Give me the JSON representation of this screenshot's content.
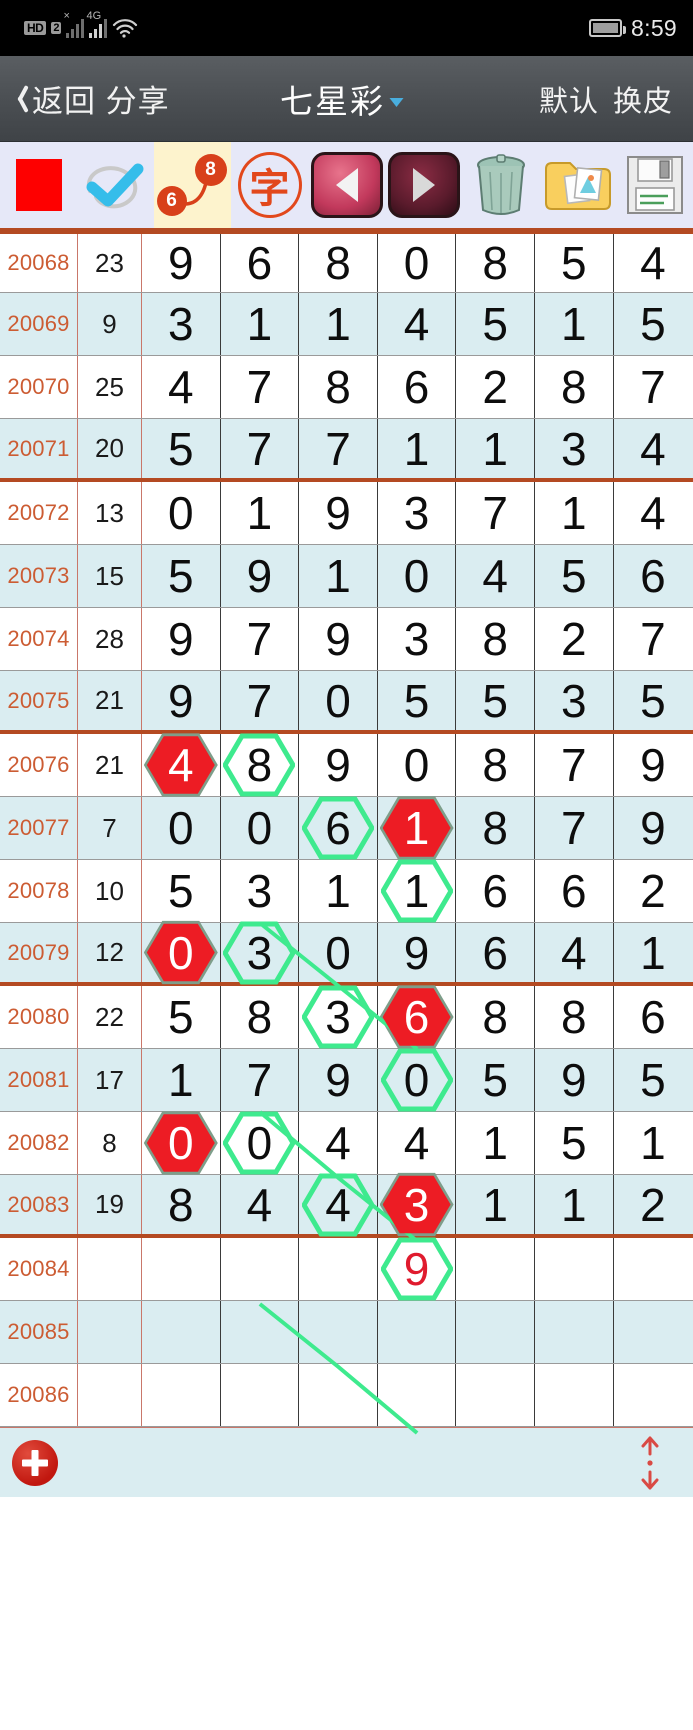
{
  "statusbar": {
    "hd_label": "HD",
    "sim_label": "2",
    "sim1_sup": "×",
    "net_label": "4G",
    "wifi_icon": "wifi-icon",
    "battery_icon": "battery-icon",
    "time": "8:59"
  },
  "appbar": {
    "back_icon": "chevron-left-icon",
    "back_label": "返回 分享",
    "title": "七星彩",
    "title_caret_icon": "chevron-down-icon",
    "action_default": "默认",
    "action_skin": "换皮"
  },
  "toolbar": {
    "items": [
      {
        "name": "red-square-icon",
        "label": "",
        "selected": false
      },
      {
        "name": "check-mark-icon",
        "label": "",
        "selected": false
      },
      {
        "name": "number-link-6-8-icon",
        "label": "6 8",
        "selected": true
      },
      {
        "name": "chinese-zi-stamp-icon",
        "label": "字",
        "selected": false
      },
      {
        "name": "prev-arrow-icon",
        "label": "",
        "selected": false
      },
      {
        "name": "next-arrow-icon",
        "label": "",
        "selected": false
      },
      {
        "name": "trash-can-icon",
        "label": "",
        "selected": false
      },
      {
        "name": "photo-folder-icon",
        "label": "",
        "selected": false
      },
      {
        "name": "floppy-save-icon",
        "label": "",
        "selected": false
      }
    ],
    "badge_6": "6",
    "badge_8": "8"
  },
  "colors": {
    "accent_orange": "#b44a22",
    "issue_text": "#cc5c33",
    "row_alt": "#daedf1",
    "marker_red": "#ed1c24",
    "marker_green": "#3eea8e",
    "prediction_red": "#e01b2e",
    "selected_tool_bg": "#fdf3cd"
  },
  "table": {
    "rows": [
      {
        "issue": "20068",
        "sum": "23",
        "nums": [
          "9",
          "6",
          "8",
          "0",
          "8",
          "5",
          "4"
        ],
        "marks": [
          null,
          null,
          null,
          null,
          null,
          null,
          null
        ]
      },
      {
        "issue": "20069",
        "sum": "9",
        "nums": [
          "3",
          "1",
          "1",
          "4",
          "5",
          "1",
          "5"
        ],
        "marks": [
          null,
          null,
          null,
          null,
          null,
          null,
          null
        ]
      },
      {
        "issue": "20070",
        "sum": "25",
        "nums": [
          "4",
          "7",
          "8",
          "6",
          "2",
          "8",
          "7"
        ],
        "marks": [
          null,
          null,
          null,
          null,
          null,
          null,
          null
        ]
      },
      {
        "issue": "20071",
        "sum": "20",
        "nums": [
          "5",
          "7",
          "7",
          "1",
          "1",
          "3",
          "4"
        ],
        "marks": [
          null,
          null,
          null,
          null,
          null,
          null,
          null
        ]
      },
      {
        "issue": "20072",
        "sum": "13",
        "nums": [
          "0",
          "1",
          "9",
          "3",
          "7",
          "1",
          "4"
        ],
        "marks": [
          null,
          null,
          null,
          null,
          null,
          null,
          null
        ]
      },
      {
        "issue": "20073",
        "sum": "15",
        "nums": [
          "5",
          "9",
          "1",
          "0",
          "4",
          "5",
          "6"
        ],
        "marks": [
          null,
          null,
          null,
          null,
          null,
          null,
          null
        ]
      },
      {
        "issue": "20074",
        "sum": "28",
        "nums": [
          "9",
          "7",
          "9",
          "3",
          "8",
          "2",
          "7"
        ],
        "marks": [
          null,
          null,
          null,
          null,
          null,
          null,
          null
        ]
      },
      {
        "issue": "20075",
        "sum": "21",
        "nums": [
          "9",
          "7",
          "0",
          "5",
          "5",
          "3",
          "5"
        ],
        "marks": [
          null,
          null,
          null,
          null,
          null,
          null,
          null
        ]
      },
      {
        "issue": "20076",
        "sum": "21",
        "nums": [
          "4",
          "8",
          "9",
          "0",
          "8",
          "7",
          "9"
        ],
        "marks": [
          "red",
          "green",
          null,
          null,
          null,
          null,
          null
        ]
      },
      {
        "issue": "20077",
        "sum": "7",
        "nums": [
          "0",
          "0",
          "6",
          "1",
          "8",
          "7",
          "9"
        ],
        "marks": [
          null,
          null,
          "green",
          "red",
          null,
          null,
          null
        ]
      },
      {
        "issue": "20078",
        "sum": "10",
        "nums": [
          "5",
          "3",
          "1",
          "1",
          "6",
          "6",
          "2"
        ],
        "marks": [
          null,
          null,
          null,
          "green",
          null,
          null,
          null
        ]
      },
      {
        "issue": "20079",
        "sum": "12",
        "nums": [
          "0",
          "3",
          "0",
          "9",
          "6",
          "4",
          "1"
        ],
        "marks": [
          "red",
          "green",
          null,
          null,
          null,
          null,
          null
        ]
      },
      {
        "issue": "20080",
        "sum": "22",
        "nums": [
          "5",
          "8",
          "3",
          "6",
          "8",
          "8",
          "6"
        ],
        "marks": [
          null,
          null,
          "green",
          "red",
          null,
          null,
          null
        ]
      },
      {
        "issue": "20081",
        "sum": "17",
        "nums": [
          "1",
          "7",
          "9",
          "0",
          "5",
          "9",
          "5"
        ],
        "marks": [
          null,
          null,
          null,
          "green",
          null,
          null,
          null
        ]
      },
      {
        "issue": "20082",
        "sum": "8",
        "nums": [
          "0",
          "0",
          "4",
          "4",
          "1",
          "5",
          "1"
        ],
        "marks": [
          "red",
          "green",
          null,
          null,
          null,
          null,
          null
        ]
      },
      {
        "issue": "20083",
        "sum": "19",
        "nums": [
          "8",
          "4",
          "4",
          "3",
          "1",
          "1",
          "2"
        ],
        "marks": [
          null,
          null,
          "green",
          "red",
          null,
          null,
          null
        ]
      },
      {
        "issue": "20084",
        "sum": "",
        "nums": [
          "",
          "",
          "",
          "9",
          "",
          "",
          ""
        ],
        "marks": [
          null,
          null,
          null,
          "pred",
          null,
          null,
          null
        ]
      },
      {
        "issue": "20085",
        "sum": "",
        "nums": [
          "",
          "",
          "",
          "",
          "",
          "",
          ""
        ],
        "marks": [
          null,
          null,
          null,
          null,
          null,
          null,
          null
        ]
      },
      {
        "issue": "20086",
        "sum": "",
        "nums": [
          "",
          "",
          "",
          "",
          "",
          "",
          ""
        ],
        "marks": [
          null,
          null,
          null,
          null,
          null,
          null,
          null
        ]
      }
    ]
  },
  "footer": {
    "add_icon": "add-plus-button",
    "scroll_icon": "scroll-up-down-icon"
  }
}
